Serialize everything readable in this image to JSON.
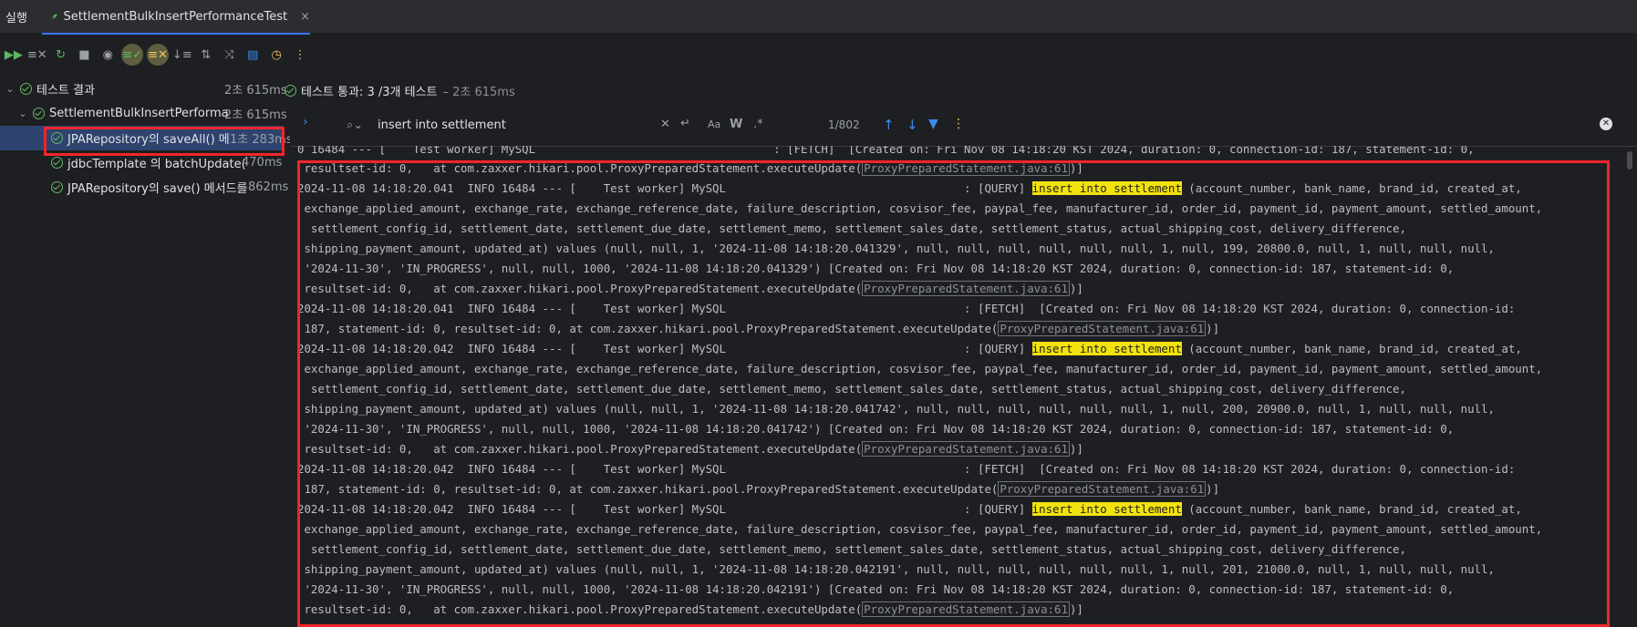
{
  "tabs": {
    "run_label": "실행",
    "active_tab": "SettlementBulkInsertPerformanceTest",
    "close": "×"
  },
  "toolbar": {
    "icons": [
      "rerun-icon",
      "rerun-failed-icon",
      "restart-icon",
      "stop-icon",
      "eye-icon",
      "sort-passed-icon",
      "sort-ignored-icon",
      "sort-icon",
      "collapse-icon",
      "coverage-icon",
      "export-icon",
      "history-icon",
      "more-icon"
    ]
  },
  "tree": {
    "root": {
      "label": "테스트 결과",
      "time": "2초 615ms"
    },
    "class": {
      "label": "SettlementBulkInsertPerforma",
      "time": "2초 615ms"
    },
    "tests": [
      {
        "label": "JPARepository의 saveAll() 메",
        "time": "1초 283ms"
      },
      {
        "label": "jdbcTemplate 의 batchUpdate(",
        "time": "470ms"
      },
      {
        "label": "JPARepository의 save() 메서드를",
        "time": "862ms"
      }
    ]
  },
  "status": {
    "passed": "테스트 통과: 3 /3개 테스트",
    "duration": "– 2초 615ms"
  },
  "find": {
    "query": "insert into settlement",
    "count": "1/802",
    "aa": "Aa",
    "w": "W"
  },
  "console": {
    "top_cut": "0 16484 --- [    Test worker] MySQL                                   : [FETCH]  [Created on: Fri Nov 08 14:18:20 KST 2024, duration: 0, connection-id: 187, statement-id: 0,",
    "highlight": "insert into settlement",
    "blocks": [
      {
        "pre": " resultset-id: 0,   at com.zaxxer.hikari.pool.ProxyPreparedStatement.executeUpdate(",
        "link": "ProxyPreparedStatement.java:61",
        "post": ")]"
      },
      {
        "query_head": "2024-11-08 14:18:20.041  INFO 16484 --- [    Test worker] MySQL                                   : [QUERY] ",
        "query_tail": " (account_number, bank_name, brand_id, created_at,",
        "lines": [
          " exchange_applied_amount, exchange_rate, exchange_reference_date, failure_description, cosvisor_fee, paypal_fee, manufacturer_id, order_id, payment_id, payment_amount, settled_amount,",
          "  settlement_config_id, settlement_date, settlement_due_date, settlement_memo, settlement_sales_date, settlement_status, actual_shipping_cost, delivery_difference,",
          " shipping_payment_amount, updated_at) values (null, null, 1, '2024-11-08 14:18:20.041329', null, null, null, null, null, null, 1, null, 199, 20800.0, null, 1, null, null, null,",
          " '2024-11-30', 'IN_PROGRESS', null, null, 1000, '2024-11-08 14:18:20.041329') [Created on: Fri Nov 08 14:18:20 KST 2024, duration: 0, connection-id: 187, statement-id: 0,"
        ],
        "last_pre": " resultset-id: 0,   at com.zaxxer.hikari.pool.ProxyPreparedStatement.executeUpdate(",
        "fetch_head": "2024-11-08 14:18:20.041  INFO 16484 --- [    Test worker] MySQL                                   : [FETCH]  [Created on: Fri Nov 08 14:18:20 KST 2024, duration: 0, connection-id:",
        "fetch_tail_pre": " 187, statement-id: 0, resultset-id: 0, at com.zaxxer.hikari.pool.ProxyPreparedStatement.executeUpdate("
      },
      {
        "query_head": "2024-11-08 14:18:20.042  INFO 16484 --- [    Test worker] MySQL                                   : [QUERY] ",
        "query_tail": " (account_number, bank_name, brand_id, created_at,",
        "lines": [
          " exchange_applied_amount, exchange_rate, exchange_reference_date, failure_description, cosvisor_fee, paypal_fee, manufacturer_id, order_id, payment_id, payment_amount, settled_amount,",
          "  settlement_config_id, settlement_date, settlement_due_date, settlement_memo, settlement_sales_date, settlement_status, actual_shipping_cost, delivery_difference,",
          " shipping_payment_amount, updated_at) values (null, null, 1, '2024-11-08 14:18:20.041742', null, null, null, null, null, null, 1, null, 200, 20900.0, null, 1, null, null, null,",
          " '2024-11-30', 'IN_PROGRESS', null, null, 1000, '2024-11-08 14:18:20.041742') [Created on: Fri Nov 08 14:18:20 KST 2024, duration: 0, connection-id: 187, statement-id: 0,"
        ],
        "last_pre": " resultset-id: 0,   at com.zaxxer.hikari.pool.ProxyPreparedStatement.executeUpdate(",
        "fetch_head": "2024-11-08 14:18:20.042  INFO 16484 --- [    Test worker] MySQL                                   : [FETCH]  [Created on: Fri Nov 08 14:18:20 KST 2024, duration: 0, connection-id:",
        "fetch_tail_pre": " 187, statement-id: 0, resultset-id: 0, at com.zaxxer.hikari.pool.ProxyPreparedStatement.executeUpdate("
      },
      {
        "query_head": "2024-11-08 14:18:20.042  INFO 16484 --- [    Test worker] MySQL                                   : [QUERY] ",
        "query_tail": " (account_number, bank_name, brand_id, created_at,",
        "lines": [
          " exchange_applied_amount, exchange_rate, exchange_reference_date, failure_description, cosvisor_fee, paypal_fee, manufacturer_id, order_id, payment_id, payment_amount, settled_amount,",
          "  settlement_config_id, settlement_date, settlement_due_date, settlement_memo, settlement_sales_date, settlement_status, actual_shipping_cost, delivery_difference,",
          " shipping_payment_amount, updated_at) values (null, null, 1, '2024-11-08 14:18:20.042191', null, null, null, null, null, null, 1, null, 201, 21000.0, null, 1, null, null, null,",
          " '2024-11-30', 'IN_PROGRESS', null, null, 1000, '2024-11-08 14:18:20.042191') [Created on: Fri Nov 08 14:18:20 KST 2024, duration: 0, connection-id: 187, statement-id: 0,"
        ],
        "last_pre": " resultset-id: 0,   at com.zaxxer.hikari.pool.ProxyPreparedStatement.executeUpdate("
      }
    ],
    "link": "ProxyPreparedStatement.java:61",
    "close_bracket": ")]"
  }
}
